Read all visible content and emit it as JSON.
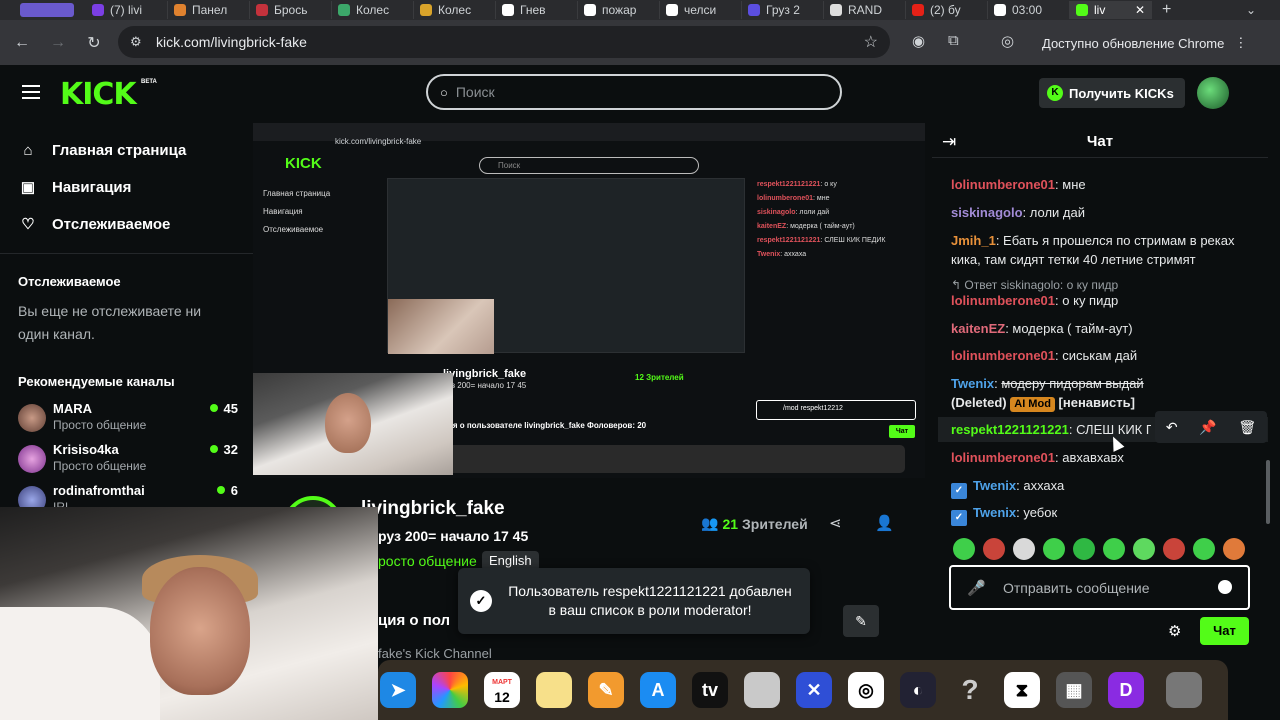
{
  "browser": {
    "tabs": [
      "(7) livi",
      "Панел",
      "Брось",
      "Колес",
      "Колес",
      "Гнев",
      "пожар",
      "челси",
      "Груз 2",
      "RAND",
      "(2) бу",
      "03:00",
      "liv"
    ],
    "active_tab": "liv",
    "url": "kick.com/livingbrick-fake",
    "update_label": "Доступно обновление Chrome"
  },
  "header": {
    "logo": "KICK",
    "logo_badge": "BETA",
    "search_placeholder": "Поиск",
    "get_kicks_label": "Получить KICKs"
  },
  "sidebar": {
    "nav": [
      {
        "label": "Главная страница",
        "icon": "home-icon"
      },
      {
        "label": "Навигация",
        "icon": "browse-icon"
      },
      {
        "label": "Отслеживаемое",
        "icon": "heart-icon"
      }
    ],
    "following_title": "Отслеживаемое",
    "following_empty": "Вы еще не отслеживаете ни один канал.",
    "recommended_title": "Рекомендуемые каналы",
    "channels": [
      {
        "name": "MARA",
        "category": "Просто общение",
        "viewers": "45"
      },
      {
        "name": "Krisiso4ka",
        "category": "Просто общение",
        "viewers": "32"
      },
      {
        "name": "rodinafromthai",
        "category": "IRL",
        "viewers": "6"
      }
    ]
  },
  "stream": {
    "channel_name": "livingbrick_fake",
    "title": "руз 200= начало 17 45",
    "category": "росто общение",
    "language": "English",
    "viewers_count": "21",
    "viewers_label": "Зрителей",
    "about_title": "ция о пол",
    "about_sub": "fake's Kick Channel"
  },
  "nested_capture": {
    "url": "kick.com/livingbrick-fake",
    "logo": "KICK",
    "search_placeholder": "Поиск",
    "sidebar_lines": [
      "Главная страница",
      "Навигация",
      "Отслеживаемое"
    ],
    "chat_lines": [
      {
        "u": "respekt1221121221",
        "t": "о ку"
      },
      {
        "u": "lolinumberone01",
        "t": "мне"
      },
      {
        "u": "siskinagolo",
        "t": "лоли дай"
      },
      {
        "u": "kaitenEZ",
        "t": "модерка ( тайм-аут)"
      },
      {
        "u": "respekt1221121221",
        "t": "СЛЕШ КИК ПЕДИК"
      },
      {
        "u": "Twenix",
        "t": "аххаха"
      }
    ],
    "channel_name": "livingbrick_fake",
    "stream_title": "руз 200= начало 17 45",
    "viewers": "12 Зрителей",
    "about": "ция о пользователе livingbrick_fake Фоловеров: 20",
    "input_text": "/mod respekt12212",
    "chat_button": "Чат"
  },
  "toast": {
    "text": "Пользователь respekt1221121221 добавлен в ваш список в роли moderator!"
  },
  "chat": {
    "title": "Чат",
    "messages": [
      {
        "user": "lolinumberone01",
        "color": "#e0525b",
        "text": "мне"
      },
      {
        "user": "siskinagolo",
        "color": "#a28bd6",
        "text": "лоли дай"
      },
      {
        "user": "Jmih_1",
        "color": "#e8913a",
        "text": "Ебать я прошелся по стримам в реках кика, там сидят тетки 40 летние стримят"
      },
      {
        "reply": "Ответ siskinagolo: о ку пидр"
      },
      {
        "user": "lolinumberone01",
        "color": "#e0525b",
        "text": "о ку пидр"
      },
      {
        "user": "kaitenEZ",
        "color": "#e06a7a",
        "text": "модерка ( тайм-аут)"
      },
      {
        "user": "lolinumberone01",
        "color": "#e0525b",
        "text": "сиськам дай"
      },
      {
        "user": "Twenix",
        "color": "#4fa3ea",
        "text": "модеру пидорам выдай",
        "deleted": "(Deleted)",
        "badge": "AI Mod",
        "reason": "[ненависть]"
      },
      {
        "user": "respekt1221121221",
        "color": "#53fc18",
        "text": "СЛЕШ КИК ПЕДИК"
      },
      {
        "user": "lolinumberone01",
        "color": "#e0525b",
        "text": "авхавхавх"
      },
      {
        "user": "Twenix",
        "color": "#4fa3ea",
        "text": "аххаха"
      },
      {
        "user": "Twenix",
        "color": "#4fa3ea",
        "text": "уебок"
      }
    ],
    "input_placeholder": "Отправить сообщение",
    "send_label": "Чат"
  },
  "dock": {
    "calendar_month": "МАРТ",
    "calendar_day": "12",
    "tv_label": "tv"
  },
  "colors": {
    "accent": "#53fc18",
    "background": "#0b0e0f"
  }
}
